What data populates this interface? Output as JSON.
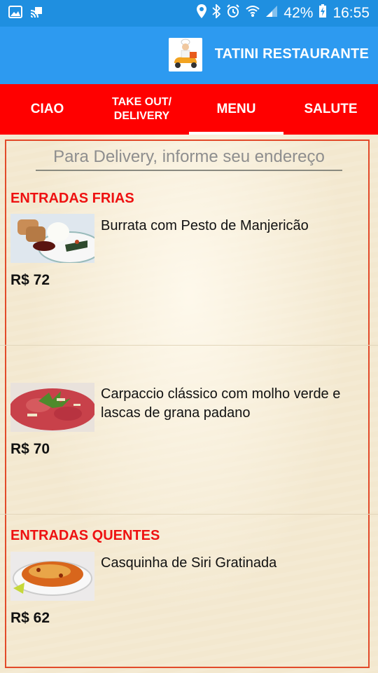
{
  "status_bar": {
    "battery": "42%",
    "time": "16:55",
    "left_icons": [
      "image-icon",
      "cast-icon"
    ],
    "right_icons": [
      "location-icon",
      "bluetooth-icon",
      "alarm-icon",
      "wifi-icon",
      "signal-icon",
      "battery-charging-icon"
    ]
  },
  "app_bar": {
    "title": "TATINI RESTAURANTE",
    "logo_icon": "delivery-chef-scooter-icon"
  },
  "tabs": [
    {
      "label": "CIAO",
      "active": false
    },
    {
      "label": "TAKE OUT/\nDELIVERY",
      "active": false
    },
    {
      "label": "MENU",
      "active": true
    },
    {
      "label": "SALUTE",
      "active": false
    }
  ],
  "search": {
    "placeholder": "Para Delivery, informe seu endereço",
    "value": ""
  },
  "menu": {
    "sections": [
      {
        "title": "ENTRADAS FRIAS",
        "items": [
          {
            "name": "Burrata com Pesto de Manjericão",
            "price": "R$ 72",
            "image": "burrata-photo"
          },
          {
            "name": "Carpaccio clássico com molho verde e lascas de grana padano",
            "price": "R$ 70",
            "image": "carpaccio-photo"
          }
        ]
      },
      {
        "title": "ENTRADAS QUENTES",
        "items": [
          {
            "name": "Casquinha de Siri Gratinada",
            "price": "R$ 62",
            "image": "casquinha-photo"
          }
        ]
      }
    ]
  },
  "colors": {
    "status_bar": "#1f8fe0",
    "app_bar": "#2d9af0",
    "tab_bar": "#ff0000",
    "section_title": "#ee1111",
    "frame_border": "#e24a2a",
    "background": "#f3e8cf"
  }
}
